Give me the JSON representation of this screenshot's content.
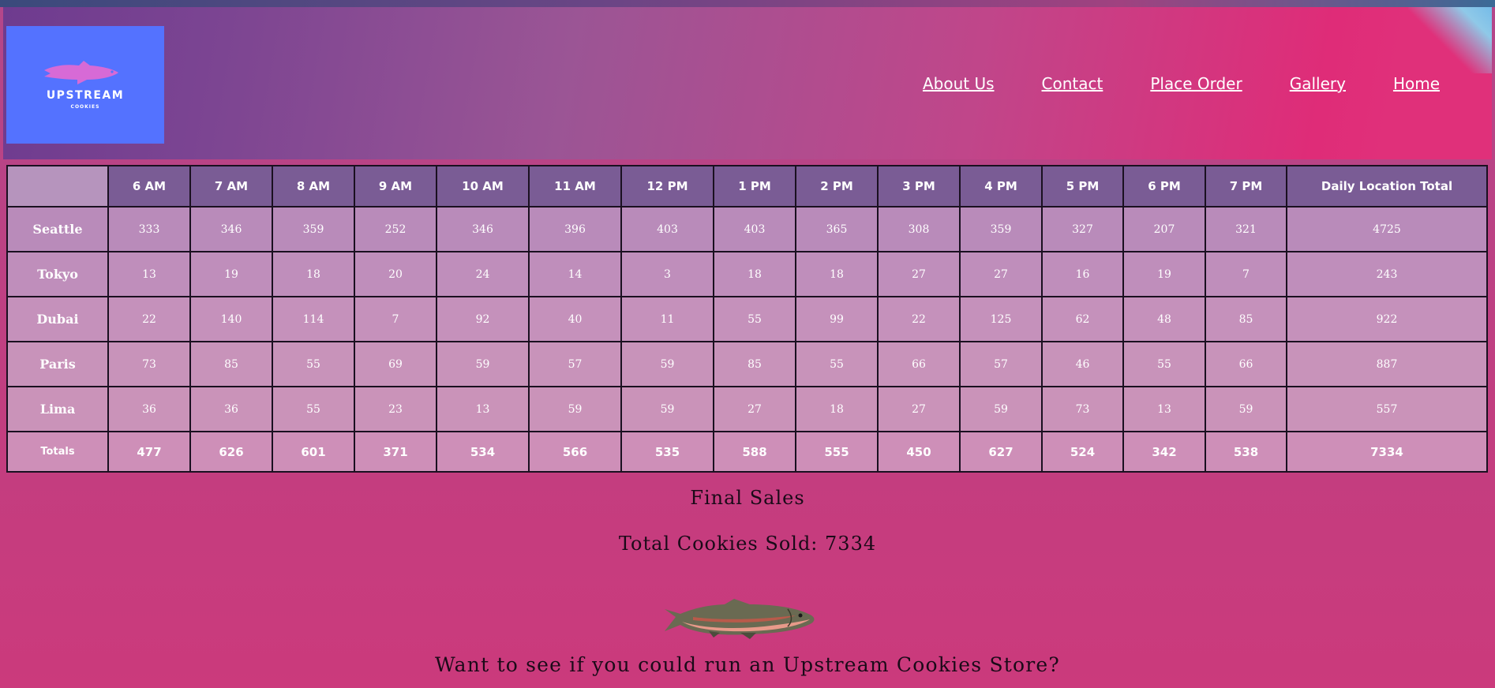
{
  "logo": {
    "title": "UPSTREAM",
    "subtitle": "COOKIES",
    "icon": "fish-icon",
    "bg_color": "#5472ff",
    "fish_color": "#d76ad6"
  },
  "nav": {
    "items": [
      {
        "label": "About Us"
      },
      {
        "label": "Contact"
      },
      {
        "label": "Place Order"
      },
      {
        "label": "Gallery"
      },
      {
        "label": "Home"
      }
    ]
  },
  "table": {
    "headers": [
      "6 AM",
      "7 AM",
      "8 AM",
      "9 AM",
      "10 AM",
      "11 AM",
      "12 PM",
      "1 PM",
      "2 PM",
      "3 PM",
      "4 PM",
      "5 PM",
      "6 PM",
      "7 PM",
      "Daily Location Total"
    ],
    "rows": [
      {
        "location": "Seattle",
        "values": [
          "333",
          "346",
          "359",
          "252",
          "346",
          "396",
          "403",
          "403",
          "365",
          "308",
          "359",
          "327",
          "207",
          "321"
        ],
        "total": "4725"
      },
      {
        "location": "Tokyo",
        "values": [
          "13",
          "19",
          "18",
          "20",
          "24",
          "14",
          "3",
          "18",
          "18",
          "27",
          "27",
          "16",
          "19",
          "7"
        ],
        "total": "243"
      },
      {
        "location": "Dubai",
        "values": [
          "22",
          "140",
          "114",
          "7",
          "92",
          "40",
          "11",
          "55",
          "99",
          "22",
          "125",
          "62",
          "48",
          "85"
        ],
        "total": "922"
      },
      {
        "location": "Paris",
        "values": [
          "73",
          "85",
          "55",
          "69",
          "59",
          "57",
          "59",
          "85",
          "55",
          "66",
          "57",
          "46",
          "55",
          "66"
        ],
        "total": "887"
      },
      {
        "location": "Lima",
        "values": [
          "36",
          "36",
          "55",
          "23",
          "13",
          "59",
          "59",
          "27",
          "18",
          "27",
          "59",
          "73",
          "13",
          "59"
        ],
        "total": "557"
      }
    ],
    "totals": {
      "label": "Totals",
      "values": [
        "477",
        "626",
        "601",
        "371",
        "534",
        "566",
        "535",
        "588",
        "555",
        "450",
        "627",
        "524",
        "342",
        "538"
      ],
      "grand_total": "7334"
    }
  },
  "summary": {
    "heading": "Final Sales",
    "total_label": "Total Cookies Sold:",
    "total_value": "7334"
  },
  "cta": {
    "image": "salmon-image",
    "text": "Want to see if you could run an Upstream Cookies Store?"
  }
}
